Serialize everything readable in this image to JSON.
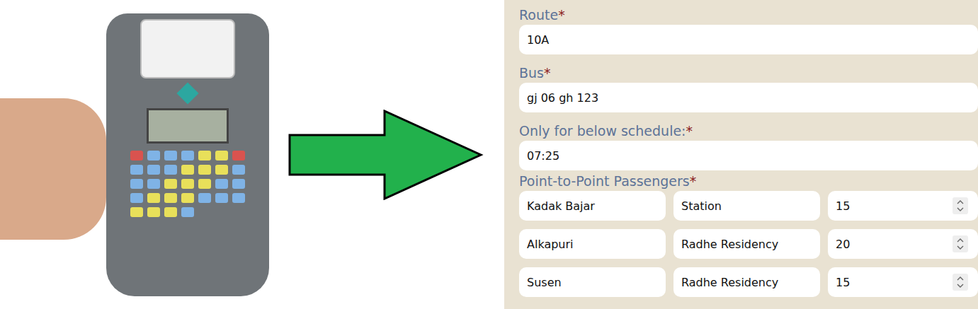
{
  "fields": [
    {
      "label": "Route",
      "required": "*",
      "value": "10A"
    },
    {
      "label": "Bus",
      "required": "*",
      "value": "gj 06 gh 123"
    },
    {
      "label": "Only for below schedule:",
      "required": "*",
      "value": "07:25"
    }
  ],
  "passengers": {
    "label": "Point-to-Point Passengers",
    "required": "*",
    "rows": [
      {
        "from": "Kadak Bajar",
        "to": "Station",
        "count": "15"
      },
      {
        "from": "Alkapuri",
        "to": "Radhe Residency",
        "count": "20"
      },
      {
        "from": "Susen",
        "to": "Radhe Residency",
        "count": "15"
      }
    ]
  }
}
